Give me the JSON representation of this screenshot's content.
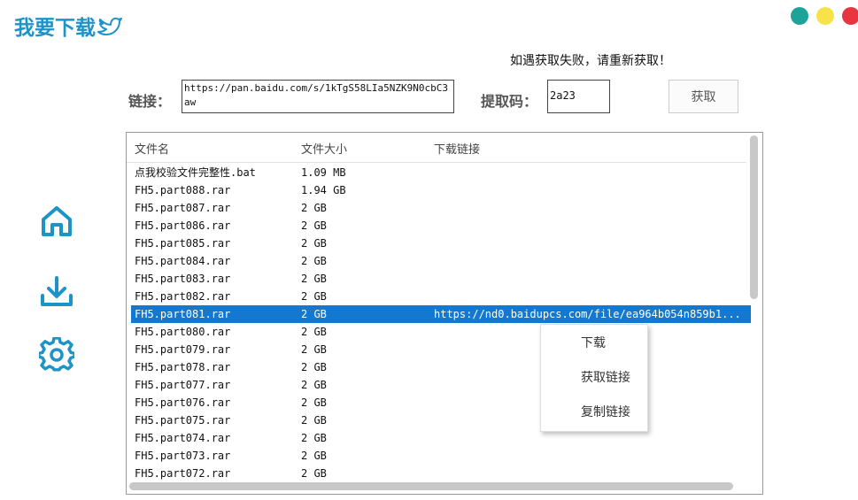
{
  "app": {
    "title": "我要下载"
  },
  "header": {
    "notice": "如遇获取失败，请重新获取！"
  },
  "form": {
    "link_label": "链接：",
    "link_value": "https://pan.baidu.com/s/1kTgS58LIa5NZK9N0cbC3aw",
    "code_label": "提取码：",
    "code_value": "2a23",
    "fetch_button": "获取"
  },
  "table": {
    "columns": [
      "文件名",
      "文件大小",
      "下载链接"
    ],
    "rows": [
      {
        "name": "点我校验文件完整性.bat",
        "size": "1.09 MB",
        "link": ""
      },
      {
        "name": "FH5.part088.rar",
        "size": "1.94 GB",
        "link": ""
      },
      {
        "name": "FH5.part087.rar",
        "size": "2 GB",
        "link": ""
      },
      {
        "name": "FH5.part086.rar",
        "size": "2 GB",
        "link": ""
      },
      {
        "name": "FH5.part085.rar",
        "size": "2 GB",
        "link": ""
      },
      {
        "name": "FH5.part084.rar",
        "size": "2 GB",
        "link": ""
      },
      {
        "name": "FH5.part083.rar",
        "size": "2 GB",
        "link": ""
      },
      {
        "name": "FH5.part082.rar",
        "size": "2 GB",
        "link": ""
      },
      {
        "name": "FH5.part081.rar",
        "size": "2 GB",
        "link": "https://nd0.baidupcs.com/file/ea964b054n859b1..."
      },
      {
        "name": "FH5.part080.rar",
        "size": "2 GB",
        "link": ""
      },
      {
        "name": "FH5.part079.rar",
        "size": "2 GB",
        "link": ""
      },
      {
        "name": "FH5.part078.rar",
        "size": "2 GB",
        "link": ""
      },
      {
        "name": "FH5.part077.rar",
        "size": "2 GB",
        "link": ""
      },
      {
        "name": "FH5.part076.rar",
        "size": "2 GB",
        "link": ""
      },
      {
        "name": "FH5.part075.rar",
        "size": "2 GB",
        "link": ""
      },
      {
        "name": "FH5.part074.rar",
        "size": "2 GB",
        "link": ""
      },
      {
        "name": "FH5.part073.rar",
        "size": "2 GB",
        "link": ""
      },
      {
        "name": "FH5.part072.rar",
        "size": "2 GB",
        "link": ""
      }
    ],
    "selected_index": 8
  },
  "context_menu": {
    "items": [
      "下载",
      "获取链接",
      "复制链接"
    ]
  },
  "sidebar": {
    "icons": [
      "home-icon",
      "download-icon",
      "settings-icon"
    ]
  },
  "colors": {
    "accent": "#1d93c8",
    "selection": "#1478d0",
    "dot_green": "#1ea39a",
    "dot_yellow": "#f6e34a",
    "dot_red": "#e8353f"
  }
}
